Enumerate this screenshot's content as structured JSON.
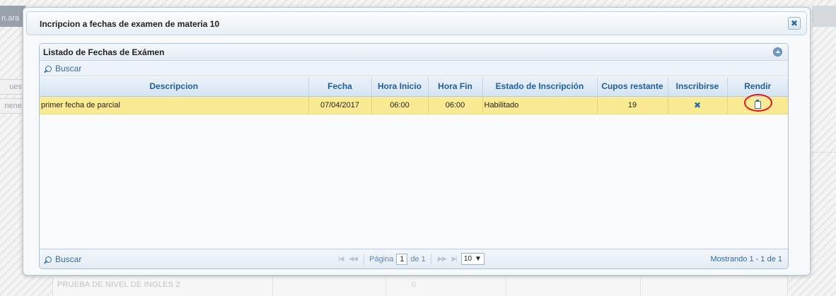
{
  "background": {
    "user_fragment": "n.ara",
    "side_tabs": [
      "ues",
      "nene"
    ],
    "bottom_row_text": "PRUEBA DE NIVEL DE INGLES 2",
    "bottom_row_value": "0"
  },
  "modal": {
    "title": "Incripcion a fechas de examen de materia 10",
    "close_icon": "close-icon"
  },
  "grid": {
    "caption": "Listado de Fechas de Exámen",
    "search_label": "Buscar",
    "columns": [
      "Descripcion",
      "Fecha",
      "Hora Inicio",
      "Hora Fin",
      "Estado de Inscripción",
      "Cupos restante",
      "Inscribirse",
      "Rendir"
    ],
    "rows": [
      {
        "descripcion": "primer fecha de parcial",
        "fecha": "07/04/2017",
        "hora_inicio": "06:00",
        "hora_fin": "06:00",
        "estado": "Habilitado",
        "cupos": "19",
        "inscribirse_icon": "x-icon",
        "rendir_icon": "clipboard-icon"
      }
    ],
    "row_highlight_color": "#fbea94"
  },
  "pager": {
    "search_label": "Buscar",
    "page_label": "Página",
    "page_value": "1",
    "of_label": "de 1",
    "page_size": "10",
    "summary": "Mostrando 1 - 1 de 1"
  },
  "colors": {
    "accent": "#2e6da4",
    "header_text": "#1e5f9c",
    "annotation_circle": "#e0161b"
  }
}
